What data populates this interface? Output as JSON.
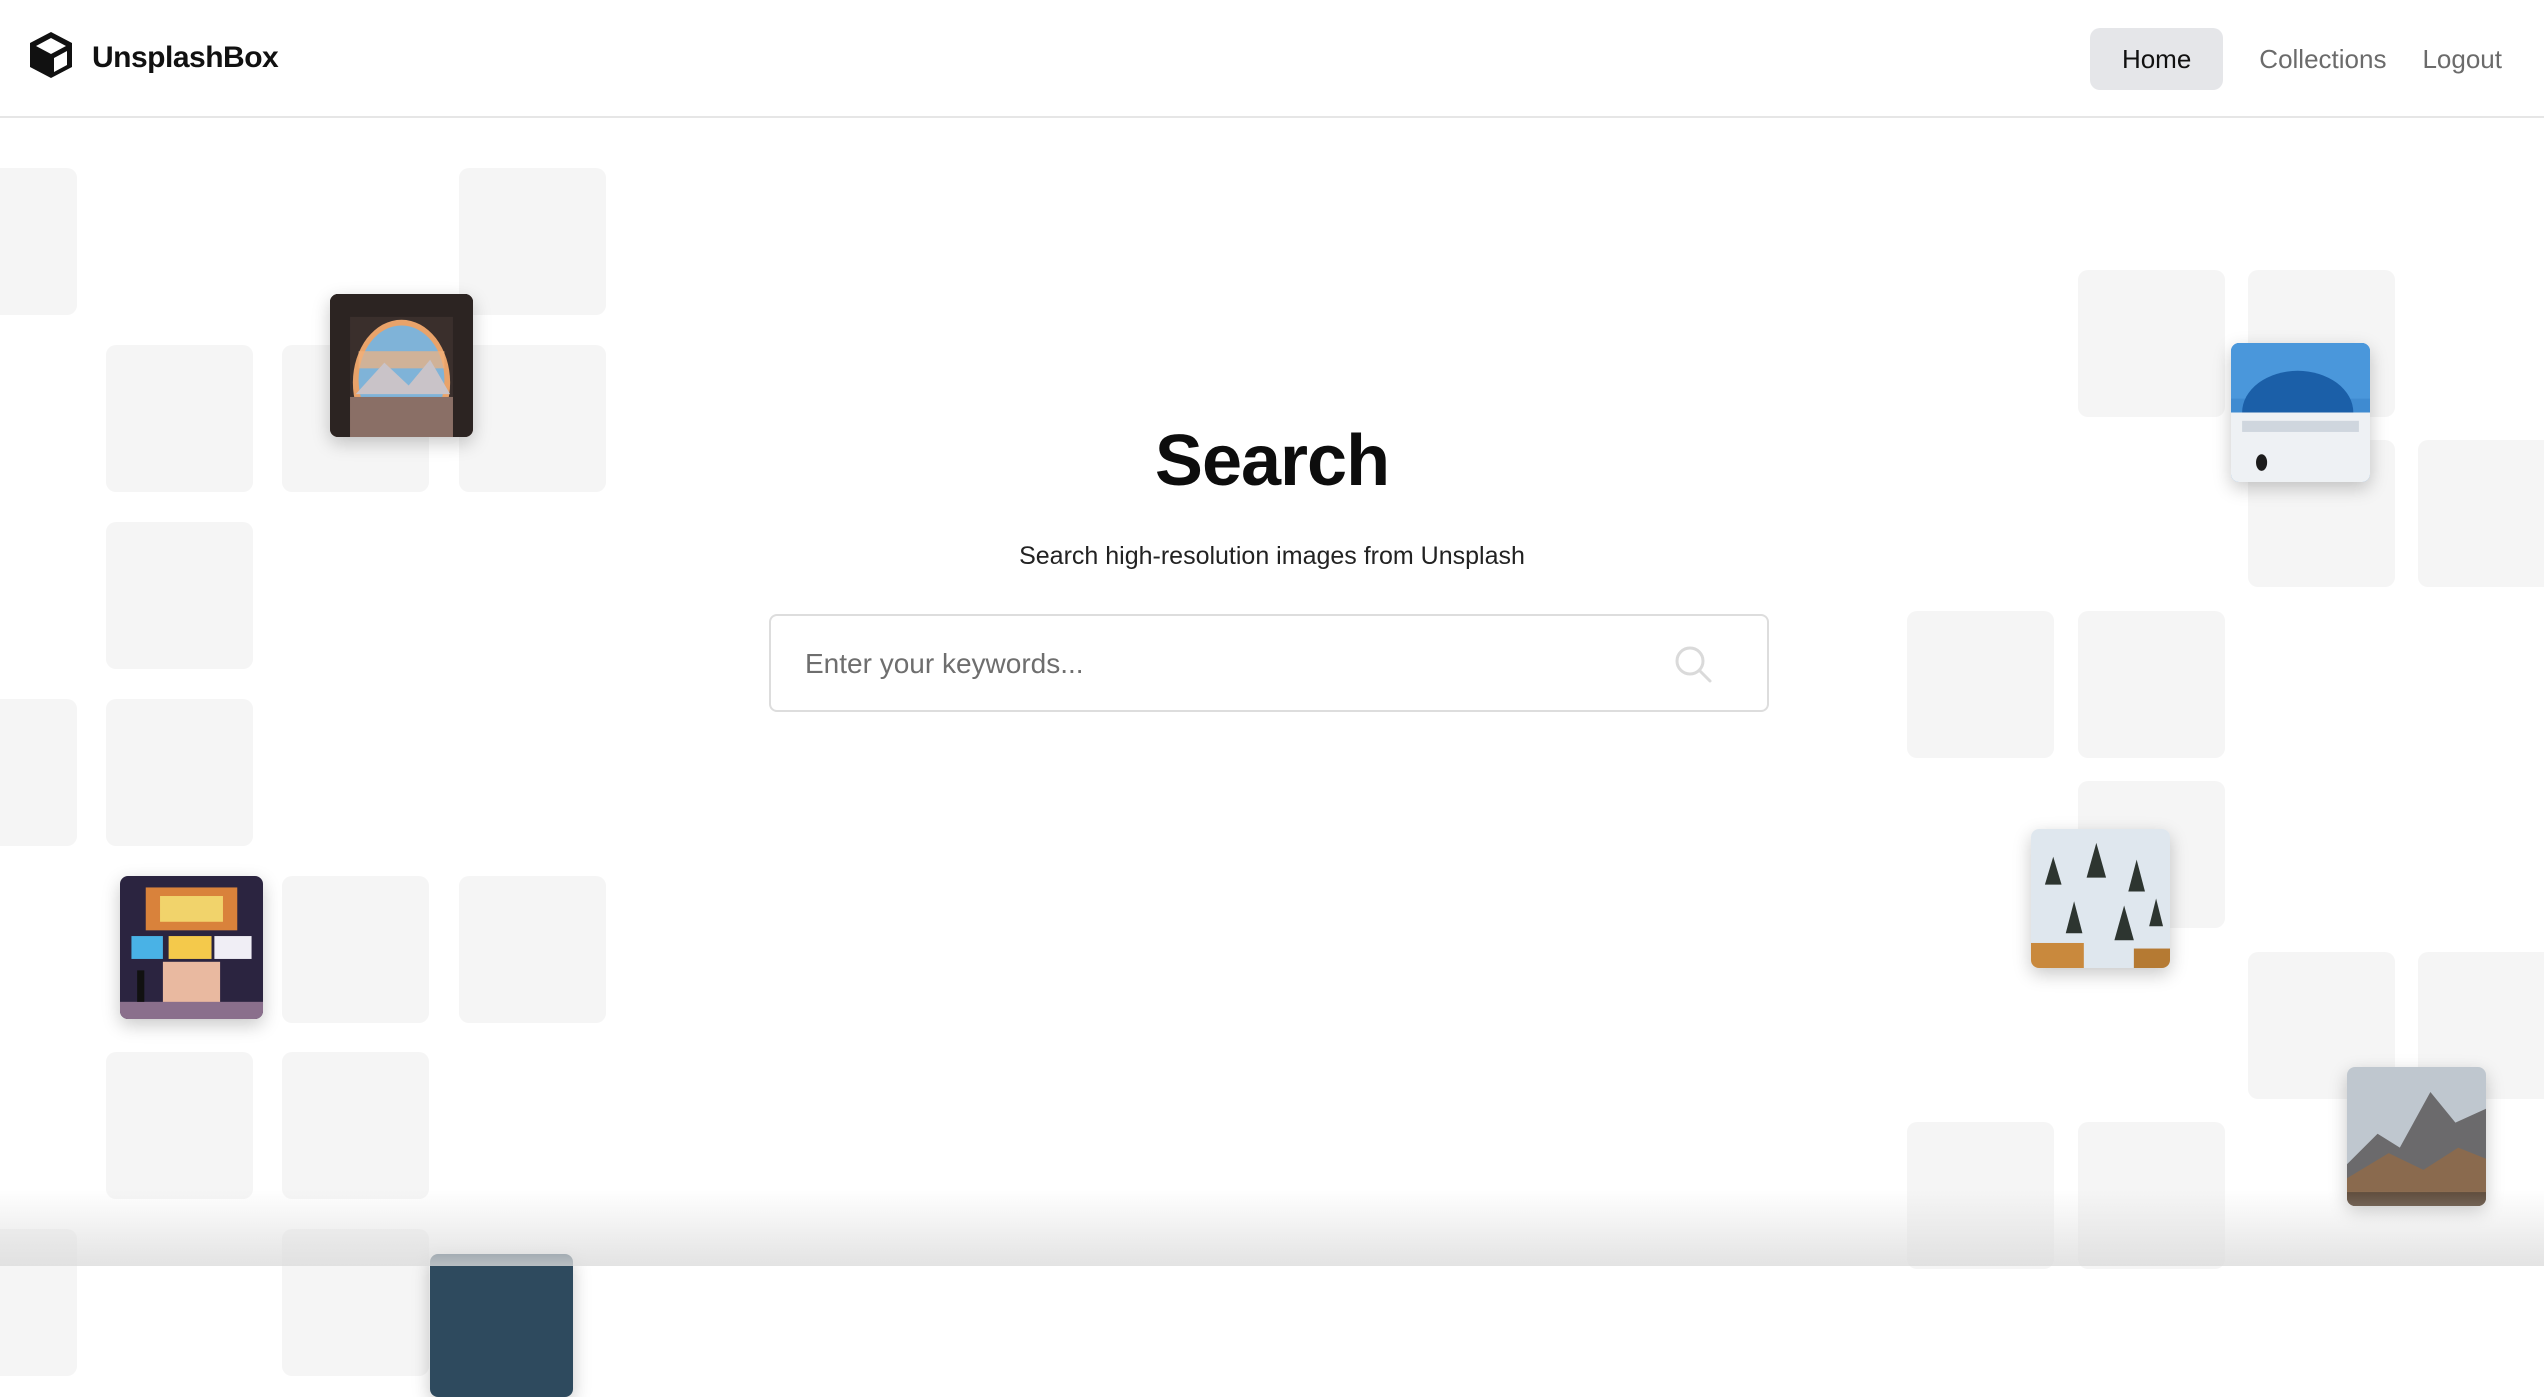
{
  "header": {
    "brand": "UnsplashBox",
    "nav": [
      {
        "label": "Home",
        "active": true
      },
      {
        "label": "Collections",
        "active": false
      },
      {
        "label": "Logout",
        "active": false
      }
    ]
  },
  "hero": {
    "title": "Search",
    "subtitle": "Search high-resolution images from Unsplash"
  },
  "search": {
    "placeholder": "Enter your keywords...",
    "value": ""
  },
  "icons": {
    "logo": "box-icon",
    "search": "search-icon"
  },
  "colors": {
    "tile": "#f5f5f5",
    "nav_active_bg": "#e5e6e9"
  }
}
